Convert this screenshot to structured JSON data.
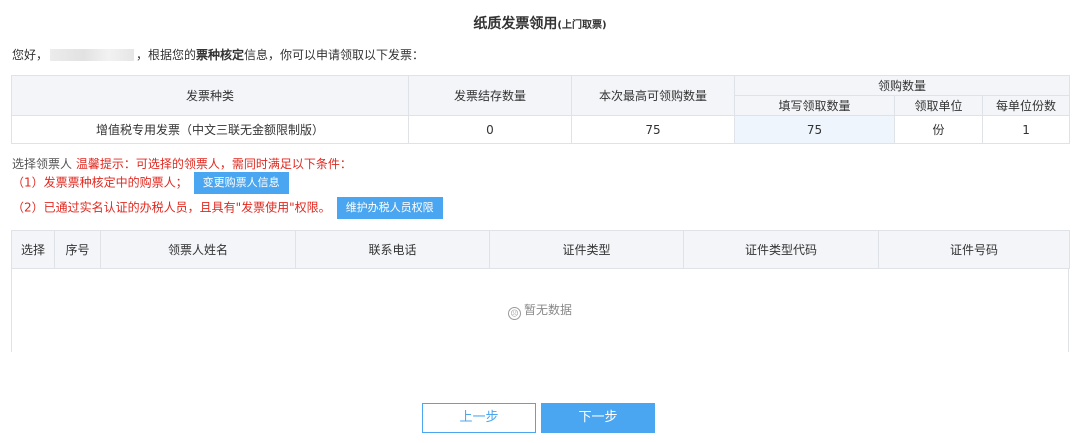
{
  "title": {
    "main": "纸质发票领用",
    "sub": "(上门取票)"
  },
  "greeting": {
    "prefix": "您好，",
    "mid": "，根据您的",
    "bold": "票种核定",
    "suffix": "信息，你可以申请领取以下发票："
  },
  "invoice_table": {
    "headers": {
      "type": "发票种类",
      "stock": "发票结存数量",
      "max": "本次最高可领购数量",
      "group": "领购数量",
      "qty": "填写领取数量",
      "unit": "领取单位",
      "per": "每单位份数"
    },
    "row": {
      "type": "增值税专用发票（中文三联无金额限制版）",
      "stock": "0",
      "max": "75",
      "qty": "75",
      "unit": "份",
      "per": "1"
    }
  },
  "notes": {
    "label": "选择领票人",
    "warn": "温馨提示：可选择的领票人，需同时满足以下条件：",
    "cond1": "（1）发票票种核定中的购票人；",
    "btn1": "变更购票人信息",
    "cond2": "（2）已通过实名认证的办税人员，且具有\"发票使用\"权限。",
    "btn2": "维护办税人员权限"
  },
  "person_table": {
    "headers": [
      "选择",
      "序号",
      "领票人姓名",
      "联系电话",
      "证件类型",
      "证件类型代码",
      "证件号码"
    ],
    "empty": "暂无数据"
  },
  "nav": {
    "prev": "上一步",
    "next": "下一步"
  },
  "colors": {
    "accent": "#4aa6f0",
    "warn": "#e0281f"
  }
}
